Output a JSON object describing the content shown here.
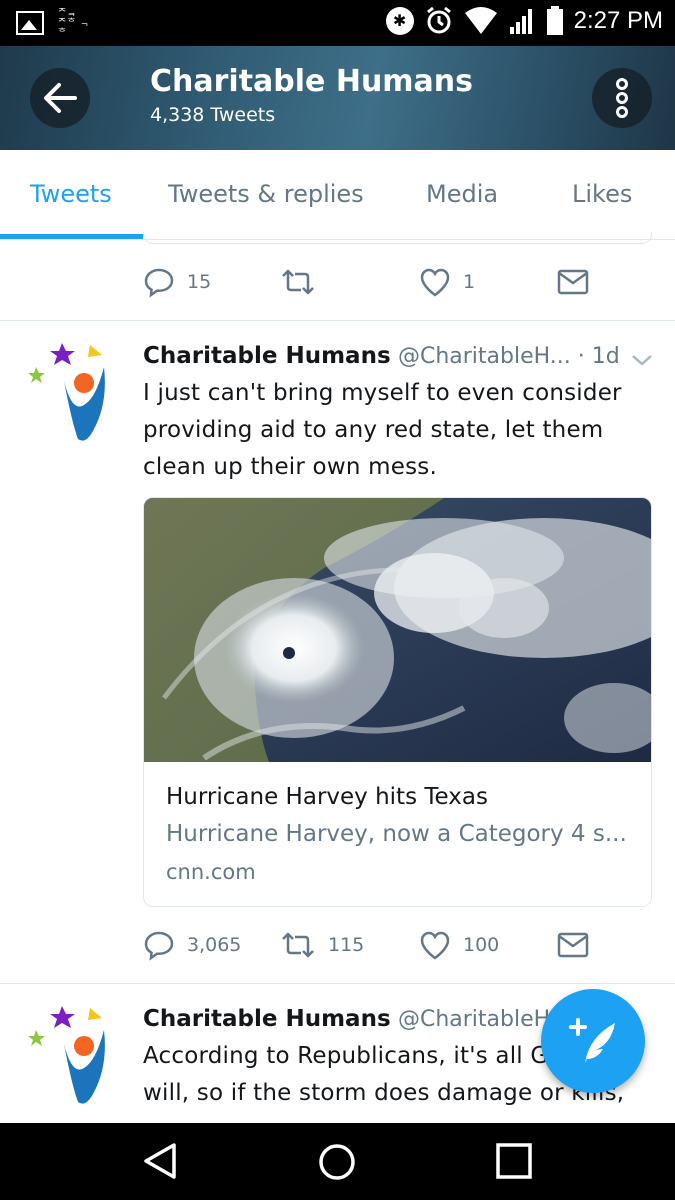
{
  "status_bar": {
    "left_glyphs": "ᄌᆿ ᄌᄒ ᆨᄒ",
    "time": "2:27 PM"
  },
  "header": {
    "title": "Charitable Humans",
    "subtitle": "4,338 Tweets"
  },
  "tabs": [
    {
      "label": "Tweets",
      "active": true
    },
    {
      "label": "Tweets & replies",
      "active": false
    },
    {
      "label": "Media",
      "active": false
    },
    {
      "label": "Likes",
      "active": false
    }
  ],
  "tweets": [
    {
      "actions": {
        "replies": "15",
        "retweets": "",
        "likes": "1"
      }
    },
    {
      "name": "Charitable Humans",
      "handle": "@CharitableH... · 1d",
      "text": "I just can't bring myself to even consider providing aid to any red state, let them clean up their own mess.",
      "card": {
        "title": "Hurricane Harvey hits Texas",
        "description": "Hurricane Harvey, now a Category 4 s...",
        "domain": "cnn.com"
      },
      "actions": {
        "replies": "3,065",
        "retweets": "115",
        "likes": "100"
      }
    },
    {
      "name": "Charitable Humans",
      "handle": "@CharitableH",
      "text_line1": "According to Republicans, it's all G",
      "text_line2": "will, so if the storm does damage or kills,"
    }
  ],
  "colors": {
    "accent": "#1da1f2",
    "secondary_text": "#657786",
    "divider": "#e1e8ed"
  },
  "icons": [
    "back-arrow-icon",
    "more-vert-icon",
    "reply-icon",
    "retweet-icon",
    "like-icon",
    "message-icon",
    "compose-icon",
    "nav-back-icon",
    "nav-home-icon",
    "nav-recents-icon"
  ]
}
